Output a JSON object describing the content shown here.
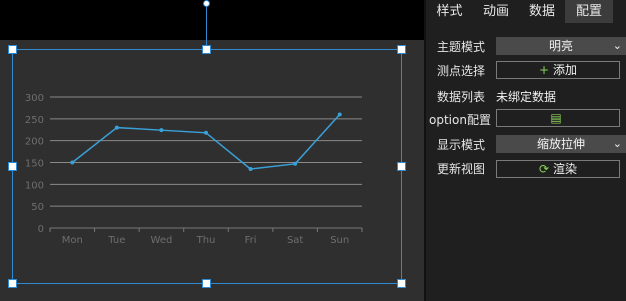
{
  "panel": {
    "tabs": [
      {
        "label": "样式"
      },
      {
        "label": "动画"
      },
      {
        "label": "数据"
      },
      {
        "label": "配置"
      }
    ],
    "rows": {
      "theme_mode": {
        "label": "主题模式",
        "value": "明亮"
      },
      "point_select": {
        "label": "测点选择",
        "button": "添加"
      },
      "data_list": {
        "label": "数据列表",
        "value": "未绑定数据"
      },
      "option_config": {
        "label": "option配置"
      },
      "display_mode": {
        "label": "显示模式",
        "value": "缩放拉伸"
      },
      "refresh_view": {
        "label": "更新视图",
        "button": "渲染"
      }
    }
  },
  "colors": {
    "accent": "#2f8ad1",
    "icon_green": "#8bd35b",
    "line": "#3aa0d8"
  },
  "chart_data": {
    "type": "line",
    "categories": [
      "Mon",
      "Tue",
      "Wed",
      "Thu",
      "Fri",
      "Sat",
      "Sun"
    ],
    "values": [
      150,
      230,
      224,
      218,
      135,
      147,
      260
    ],
    "ylim": [
      0,
      300
    ],
    "yticks": [
      0,
      50,
      100,
      150,
      200,
      250,
      300
    ],
    "title": "",
    "xlabel": "",
    "ylabel": "",
    "grid": true
  }
}
